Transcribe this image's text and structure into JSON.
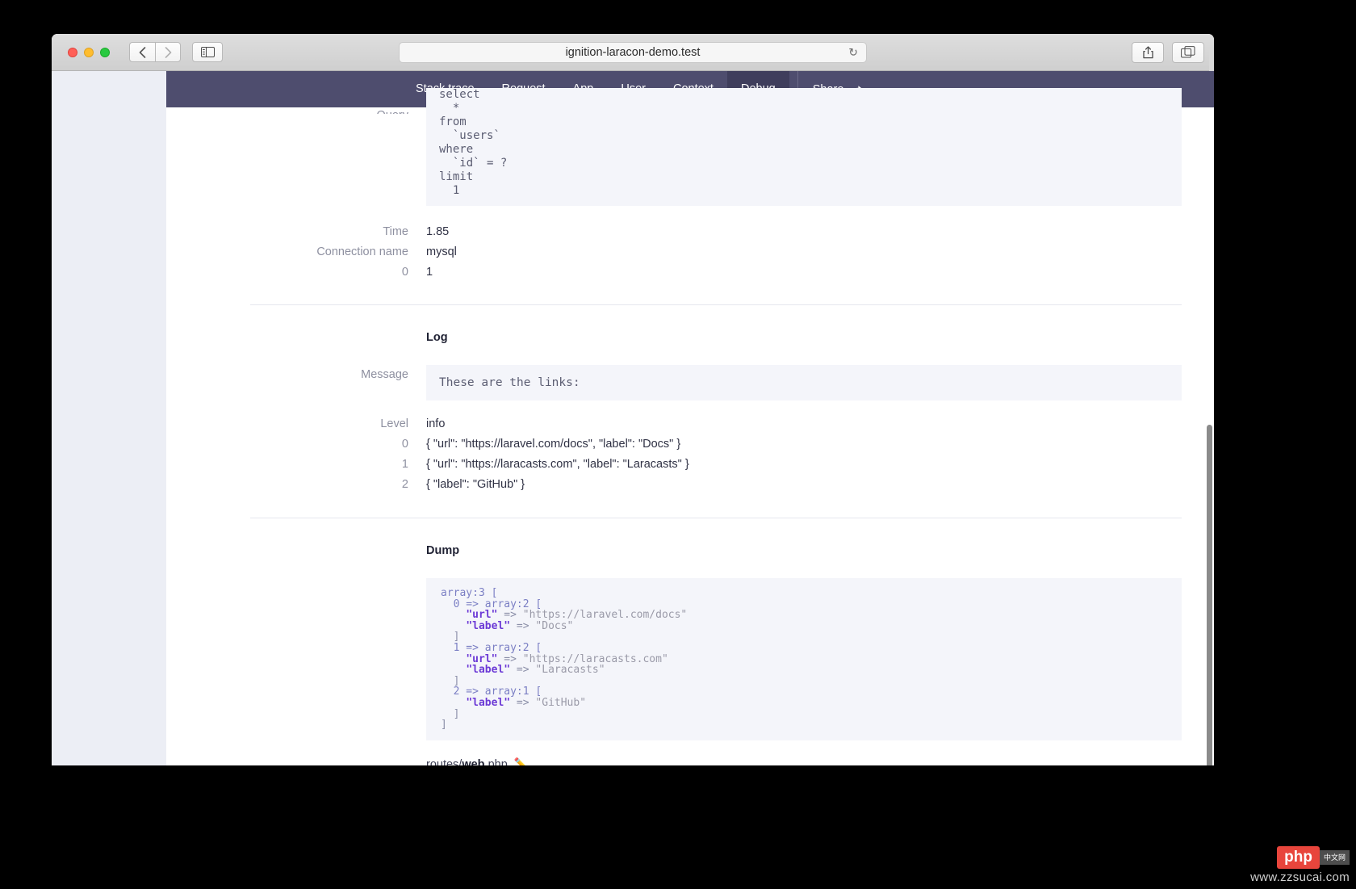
{
  "browser": {
    "url": "ignition-laracon-demo.test",
    "back_icon": "chevron-left-icon",
    "forward_icon": "chevron-right-icon",
    "sidebar_icon": "sidebar-toggle-icon",
    "reload_icon": "reload-icon",
    "share_icon": "share-icon",
    "tabs_icon": "tab-overview-icon",
    "new_tab_label": "+"
  },
  "topnav": {
    "tabs": [
      {
        "label": "Stack trace",
        "active": false
      },
      {
        "label": "Request",
        "active": false
      },
      {
        "label": "App",
        "active": false
      },
      {
        "label": "User",
        "active": false
      },
      {
        "label": "Context",
        "active": false
      },
      {
        "label": "Debug",
        "active": true
      }
    ],
    "share_label": "Share",
    "share_icon": "share-arrow-icon",
    "bg_color": "#4e4d6e",
    "active_bg_color": "#3f3e5c"
  },
  "query_section": {
    "label": "Query",
    "sql": "select\n  *\nfrom\n  `users`\nwhere\n  `id` = ?\nlimit\n  1",
    "rows": [
      {
        "label": "Time",
        "value": "1.85"
      },
      {
        "label": "Connection name",
        "value": "mysql"
      },
      {
        "label": "0",
        "value": "1"
      }
    ]
  },
  "log_section": {
    "title": "Log",
    "message_label": "Message",
    "message": "These are the links:",
    "level_label": "Level",
    "level": "info",
    "items": [
      {
        "index": "0",
        "value": "{ \"url\": \"https://laravel.com/docs\", \"label\": \"Docs\" }"
      },
      {
        "index": "1",
        "value": "{ \"url\": \"https://laracasts.com\", \"label\": \"Laracasts\" }"
      },
      {
        "index": "2",
        "value": "{ \"label\": \"GitHub\" }"
      }
    ]
  },
  "dump_section": {
    "title": "Dump",
    "lines": [
      [
        {
          "t": "array:3 [",
          "c": "struct"
        }
      ],
      [
        {
          "t": "  0 => array:2 [",
          "c": "struct"
        }
      ],
      [
        {
          "t": "    ",
          "c": "punc"
        },
        {
          "t": "\"url\"",
          "c": "key"
        },
        {
          "t": " => ",
          "c": "punc"
        },
        {
          "t": "\"https://laravel.com/docs\"",
          "c": "str"
        }
      ],
      [
        {
          "t": "    ",
          "c": "punc"
        },
        {
          "t": "\"label\"",
          "c": "key"
        },
        {
          "t": " => ",
          "c": "punc"
        },
        {
          "t": "\"Docs\"",
          "c": "str"
        }
      ],
      [
        {
          "t": "  ]",
          "c": "punc"
        }
      ],
      [
        {
          "t": "  1 => array:2 [",
          "c": "struct"
        }
      ],
      [
        {
          "t": "    ",
          "c": "punc"
        },
        {
          "t": "\"url\"",
          "c": "key"
        },
        {
          "t": " => ",
          "c": "punc"
        },
        {
          "t": "\"https://laracasts.com\"",
          "c": "str"
        }
      ],
      [
        {
          "t": "    ",
          "c": "punc"
        },
        {
          "t": "\"label\"",
          "c": "key"
        },
        {
          "t": " => ",
          "c": "punc"
        },
        {
          "t": "\"Laracasts\"",
          "c": "str"
        }
      ],
      [
        {
          "t": "  ]",
          "c": "punc"
        }
      ],
      [
        {
          "t": "  2 => array:1 [",
          "c": "struct"
        }
      ],
      [
        {
          "t": "    ",
          "c": "punc"
        },
        {
          "t": "\"label\"",
          "c": "key"
        },
        {
          "t": " => ",
          "c": "punc"
        },
        {
          "t": "\"GitHub\"",
          "c": "str"
        }
      ],
      [
        {
          "t": "  ]",
          "c": "punc"
        }
      ],
      [
        {
          "t": "]",
          "c": "punc"
        }
      ]
    ],
    "file_prefix": "routes/",
    "file_bold": "web",
    "file_suffix": ".php",
    "edit_icon": "pencil-icon"
  },
  "watermark": {
    "badge": "php",
    "cn_line1": "中文网",
    "url": "www.zzsucai.com"
  }
}
